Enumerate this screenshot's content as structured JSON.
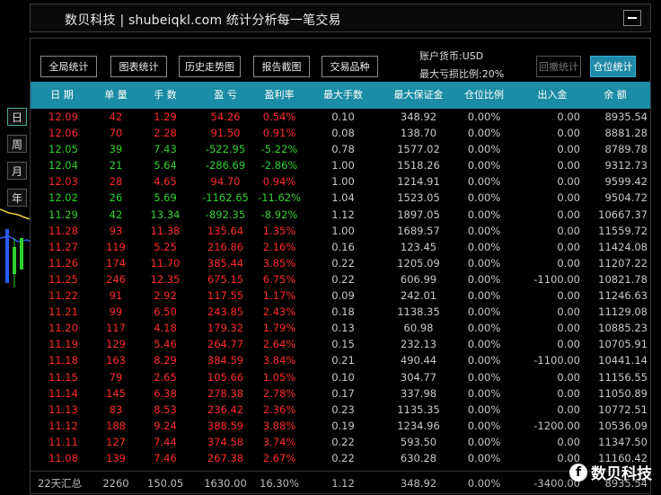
{
  "window": {
    "title": "数贝科技 | shubeiqkl.com 统计分析每一笔交易"
  },
  "sidebar": {
    "timeframes": [
      "日",
      "周",
      "月",
      "年"
    ]
  },
  "toolbar": {
    "buttons": [
      "全局统计",
      "图表统计",
      "历史走势图",
      "报告截图",
      "交易品种"
    ],
    "right_buttons": [
      "回撤统计",
      "仓位统计"
    ],
    "currency": "账户货币:USD",
    "max_loss": "最大亏损比例:20%"
  },
  "table": {
    "headers": [
      "日 期",
      "单 量",
      "手 数",
      "盈 亏",
      "盈利率",
      "最大手数",
      "最大保证金",
      "仓位比例",
      "出入金",
      "余 额"
    ],
    "rows": [
      {
        "c": "r",
        "v": [
          "12.09",
          "42",
          "1.29",
          "54.26",
          "0.54%",
          "0.10",
          "348.92",
          "0.00%",
          "0.00",
          "8935.54"
        ]
      },
      {
        "c": "r",
        "v": [
          "12.06",
          "70",
          "2.28",
          "91.50",
          "0.91%",
          "0.08",
          "138.70",
          "0.00%",
          "0.00",
          "8881.28"
        ]
      },
      {
        "c": "g",
        "v": [
          "12.05",
          "39",
          "7.43",
          "-522.95",
          "-5.22%",
          "0.78",
          "1577.02",
          "0.00%",
          "0.00",
          "8789.78"
        ]
      },
      {
        "c": "g",
        "v": [
          "12.04",
          "21",
          "5.64",
          "-286.69",
          "-2.86%",
          "1.00",
          "1518.26",
          "0.00%",
          "0.00",
          "9312.73"
        ]
      },
      {
        "c": "r",
        "v": [
          "12.03",
          "28",
          "4.65",
          "94.70",
          "0.94%",
          "1.00",
          "1214.91",
          "0.00%",
          "0.00",
          "9599.42"
        ]
      },
      {
        "c": "g",
        "v": [
          "12.02",
          "26",
          "5.69",
          "-1162.65",
          "-11.62%",
          "1.04",
          "1523.05",
          "0.00%",
          "0.00",
          "9504.72"
        ]
      },
      {
        "c": "g",
        "v": [
          "11.29",
          "42",
          "13.34",
          "-892.35",
          "-8.92%",
          "1.12",
          "1897.05",
          "0.00%",
          "0.00",
          "10667.37"
        ]
      },
      {
        "c": "r",
        "v": [
          "11.28",
          "93",
          "11.38",
          "135.64",
          "1.35%",
          "1.00",
          "1689.57",
          "0.00%",
          "0.00",
          "11559.72"
        ]
      },
      {
        "c": "r",
        "v": [
          "11.27",
          "119",
          "5.25",
          "216.86",
          "2.16%",
          "0.16",
          "123.45",
          "0.00%",
          "0.00",
          "11424.08"
        ]
      },
      {
        "c": "r",
        "v": [
          "11.26",
          "174",
          "11.70",
          "385.44",
          "3.85%",
          "0.22",
          "1205.09",
          "0.00%",
          "0.00",
          "11207.22"
        ]
      },
      {
        "c": "r",
        "v": [
          "11.25",
          "246",
          "12.35",
          "675.15",
          "6.75%",
          "0.22",
          "606.99",
          "0.00%",
          "-1100.00",
          "10821.78"
        ]
      },
      {
        "c": "r",
        "v": [
          "11.22",
          "91",
          "2.92",
          "117.55",
          "1.17%",
          "0.09",
          "242.01",
          "0.00%",
          "0.00",
          "11246.63"
        ]
      },
      {
        "c": "r",
        "v": [
          "11.21",
          "99",
          "6.50",
          "243.85",
          "2.43%",
          "0.18",
          "1138.35",
          "0.00%",
          "0.00",
          "11129.08"
        ]
      },
      {
        "c": "r",
        "v": [
          "11.20",
          "117",
          "4.18",
          "179.32",
          "1.79%",
          "0.13",
          "60.98",
          "0.00%",
          "0.00",
          "10885.23"
        ]
      },
      {
        "c": "r",
        "v": [
          "11.19",
          "129",
          "5.46",
          "264.77",
          "2.64%",
          "0.15",
          "232.13",
          "0.00%",
          "0.00",
          "10705.91"
        ]
      },
      {
        "c": "r",
        "v": [
          "11.18",
          "163",
          "8.29",
          "384.59",
          "3.84%",
          "0.21",
          "490.44",
          "0.00%",
          "-1100.00",
          "10441.14"
        ]
      },
      {
        "c": "r",
        "v": [
          "11.15",
          "79",
          "2.65",
          "105.66",
          "1.05%",
          "0.10",
          "304.77",
          "0.00%",
          "0.00",
          "11156.55"
        ]
      },
      {
        "c": "r",
        "v": [
          "11.14",
          "145",
          "6.38",
          "278.38",
          "2.78%",
          "0.17",
          "337.98",
          "0.00%",
          "0.00",
          "11050.89"
        ]
      },
      {
        "c": "r",
        "v": [
          "11.13",
          "83",
          "8.53",
          "236.42",
          "2.36%",
          "0.23",
          "1135.35",
          "0.00%",
          "0.00",
          "10772.51"
        ]
      },
      {
        "c": "r",
        "v": [
          "11.12",
          "188",
          "9.24",
          "388.59",
          "3.88%",
          "0.19",
          "1234.96",
          "0.00%",
          "-1200.00",
          "10536.09"
        ]
      },
      {
        "c": "r",
        "v": [
          "11.11",
          "127",
          "7.44",
          "374.58",
          "3.74%",
          "0.22",
          "593.50",
          "0.00%",
          "0.00",
          "11347.50"
        ]
      },
      {
        "c": "r",
        "v": [
          "11.08",
          "139",
          "7.46",
          "267.38",
          "2.67%",
          "0.22",
          "630.28",
          "0.00%",
          "0.00",
          "11160.42"
        ]
      }
    ],
    "summary": [
      "22天汇总",
      "2260",
      "150.05",
      "1630.00",
      "16.30%",
      "1.12",
      "348.92",
      "0.00%",
      "-3400.00",
      "8935.54"
    ]
  },
  "watermark": {
    "text": "数贝科技",
    "icon": "facebook-icon"
  },
  "colors": {
    "header_bg": "#1a8ca6",
    "profit": "#ff2a2a",
    "loss": "#2ed22e",
    "active_btn": "#1f8aa8"
  }
}
